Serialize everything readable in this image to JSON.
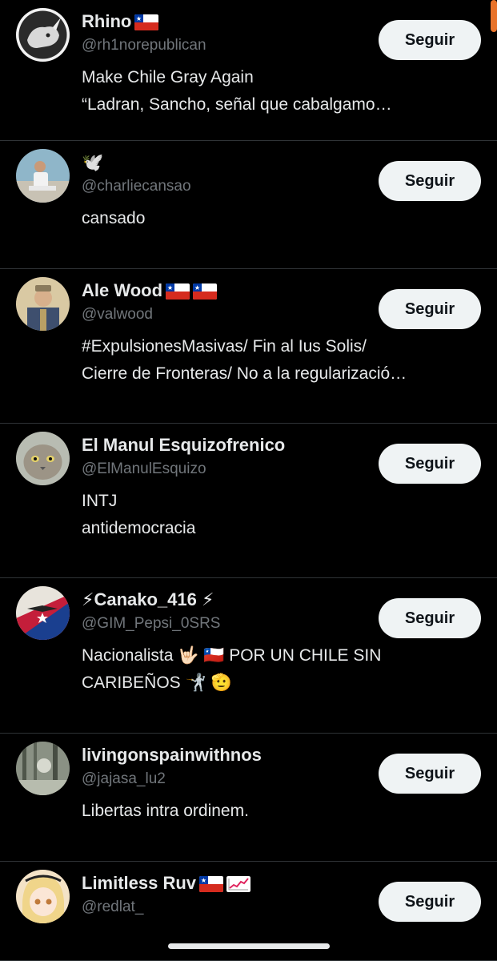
{
  "follow_label": "Seguir",
  "users": [
    {
      "name": "Rhino",
      "flags": [
        "chile"
      ],
      "handle": "@rh1norepublican",
      "bio": "Make Chile Gray Again\n“Ladran, Sancho, señal que cabalgamo…",
      "avatar": "rhino-avatar"
    },
    {
      "name": "🕊️",
      "flags": [],
      "handle": "@charliecansao",
      "bio": "cansado",
      "avatar": "photo-avatar"
    },
    {
      "name": "Ale Wood",
      "flags": [
        "chile",
        "chile"
      ],
      "handle": "@valwood",
      "bio": "#ExpulsionesMasivas/ Fin al Ius Solis/\nCierre de Fronteras/ No a la regularizació…",
      "avatar": "portrait-avatar"
    },
    {
      "name": "El Manul Esquizofrenico",
      "flags": [],
      "handle": "@ElManulEsquizo",
      "bio": "INTJ\nantidemocracia",
      "avatar": "cat-avatar"
    },
    {
      "name": "⚡Canako_416 ⚡",
      "flags": [],
      "handle": "@GIM_Pepsi_0SRS",
      "bio": "Nacionalista 🤟🏻 🇨🇱 POR UN CHILE SIN\nCARIBEÑOS 🤺 🫡",
      "avatar": "emblem-avatar"
    },
    {
      "name": "livingonspainwithnos",
      "flags": [],
      "handle": "@jajasa_lu2",
      "bio": "Libertas intra ordinem.",
      "avatar": "forest-avatar"
    },
    {
      "name": "Limitless Ruv",
      "flags": [
        "chile",
        "chart"
      ],
      "handle": "@redlat_",
      "bio": "",
      "avatar": "anime-avatar"
    }
  ],
  "colors": {
    "background": "#000000",
    "text": "#e7e9ea",
    "secondary": "#71767b",
    "button": "#eff3f4",
    "divider": "#2f3336"
  }
}
